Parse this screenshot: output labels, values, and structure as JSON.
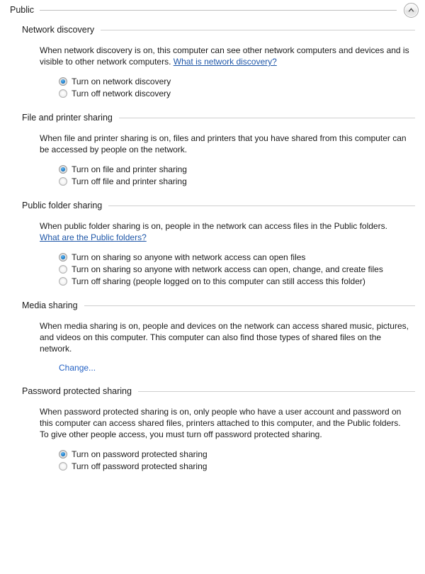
{
  "group": {
    "title": "Public",
    "collapse_icon": "chevron-up-icon",
    "collapsed": false
  },
  "colors": {
    "link": "#1f57a8",
    "plain_link": "#2361c4",
    "radio_accent": "#2d8ed8",
    "rule": "#cfcfcf",
    "text": "#1b1b1b",
    "background": "#ffffff"
  },
  "sections": [
    {
      "id": "network-discovery",
      "title": "Network discovery",
      "description_before": "When network discovery is on, this computer can see other network computers and devices and is visible to other network computers. ",
      "link_text": "What is network discovery?",
      "description_after": "",
      "options": [
        {
          "label": "Turn on network discovery",
          "checked": true
        },
        {
          "label": "Turn off network discovery",
          "checked": false
        }
      ]
    },
    {
      "id": "file-and-printer-sharing",
      "title": "File and printer sharing",
      "description_before": "When file and printer sharing is on, files and printers that you have shared from this computer can be accessed by people on the network.",
      "link_text": "",
      "description_after": "",
      "options": [
        {
          "label": "Turn on file and printer sharing",
          "checked": true
        },
        {
          "label": "Turn off file and printer sharing",
          "checked": false
        }
      ]
    },
    {
      "id": "public-folder-sharing",
      "title": "Public folder sharing",
      "description_before": "When public folder sharing is on, people in the network can access files in the Public folders. ",
      "link_text": "What are the Public folders?",
      "description_after": "",
      "options": [
        {
          "label": "Turn on sharing so anyone with network access can open files",
          "checked": true
        },
        {
          "label": "Turn on sharing so anyone with network access can open, change, and create files",
          "checked": false
        },
        {
          "label": "Turn off sharing (people logged on to this computer can still access this folder)",
          "checked": false
        }
      ]
    },
    {
      "id": "media-sharing",
      "title": "Media sharing",
      "description_before": "When media sharing is on, people and devices on the network can access shared music, pictures, and videos on this computer. This computer can also find those types of shared files on the network.",
      "link_text": "",
      "description_after": "",
      "options": [],
      "action_link": "Change..."
    },
    {
      "id": "password-protected-sharing",
      "title": "Password protected sharing",
      "description_before": "When password protected sharing is on, only people who have a user account and password on this computer can access shared files, printers attached to this computer, and the Public folders. To give other people access, you must turn off password protected sharing.",
      "link_text": "",
      "description_after": "",
      "options": [
        {
          "label": "Turn on password protected sharing",
          "checked": true
        },
        {
          "label": "Turn off password protected sharing",
          "checked": false
        }
      ]
    }
  ]
}
